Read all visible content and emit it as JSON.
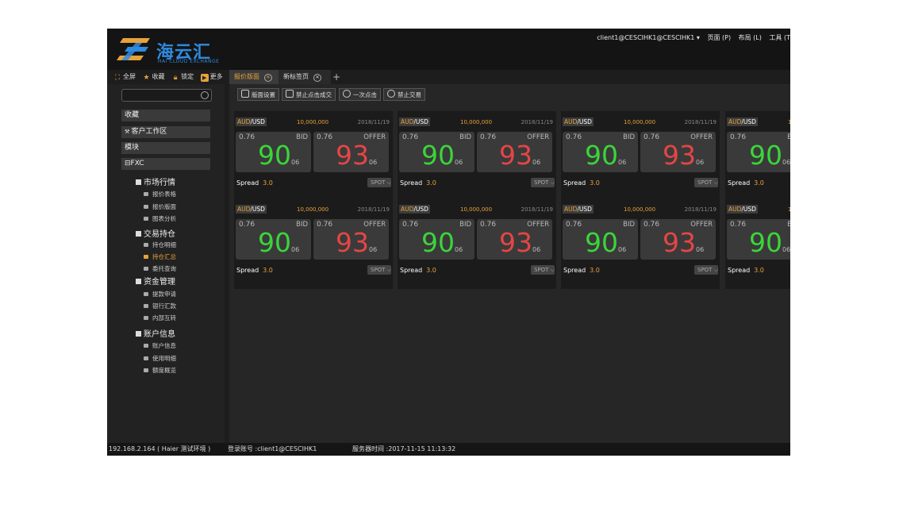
{
  "header": {
    "logo_text": "海云汇",
    "logo_sub": "HAI CLOUD EXCHANGE",
    "user": "client1@CESCIHK1@CESCIHK1 ▾",
    "menu": [
      "页面 (P)",
      "布局 (L)",
      "工具 (T"
    ]
  },
  "quickbar": [
    {
      "icon": "expand-icon",
      "label": "全屏"
    },
    {
      "icon": "star-icon",
      "label": "收藏"
    },
    {
      "icon": "lock-icon",
      "label": "锁定"
    },
    {
      "icon": "more-icon",
      "label": "更多"
    }
  ],
  "tabs": [
    {
      "label": "报价版面",
      "active": true
    },
    {
      "label": "新标签页",
      "active": false
    }
  ],
  "tab_add": "+",
  "sidebar": {
    "search_placeholder": "",
    "favorites": "收藏",
    "client_workspace": "客户工作区",
    "modules": "模块",
    "fxc": "FXC",
    "groups": [
      {
        "label": "市场行情",
        "items": [
          "报价表格",
          "报价版面",
          "图表分析"
        ]
      },
      {
        "label": "交易持仓",
        "items": [
          "持仓明细",
          "持仓汇总",
          "委托查询"
        ]
      },
      {
        "label": "资金管理",
        "items": [
          "提款申请",
          "银行汇款",
          "内部互转"
        ]
      },
      {
        "label": "账户信息",
        "items": [
          "账户信息",
          "使用明细",
          "额度概览"
        ]
      }
    ],
    "active_item": "持仓汇总"
  },
  "actions": [
    "版面设置",
    "禁止点击成交",
    "一次点击",
    "禁止交易"
  ],
  "quote": {
    "base": "AUD",
    "quote_ccy": "/USD",
    "amount": "10,000,000",
    "date": "2018/11/19",
    "bid_pre": "0.76",
    "bid_label": "BID",
    "bid_big": "90",
    "bid_pip": "06",
    "offer_pre": "0.76",
    "offer_label": "OFFER",
    "offer_big": "93",
    "offer_pip": "06",
    "spread_label": "Spread",
    "spread_value": "3.0",
    "spot": "SPOT"
  },
  "status": {
    "ip": "192.168.2.164 ( Haier 测试环境 )",
    "login": "登录账号 :client1@CESCIHK1",
    "server_time": "服务器时间 :2017-11-15  11:13:32"
  },
  "colors": {
    "accent": "#e7a23a",
    "bid": "#3bd53b",
    "offer": "#e64545",
    "logo": "#2f8ae0"
  }
}
